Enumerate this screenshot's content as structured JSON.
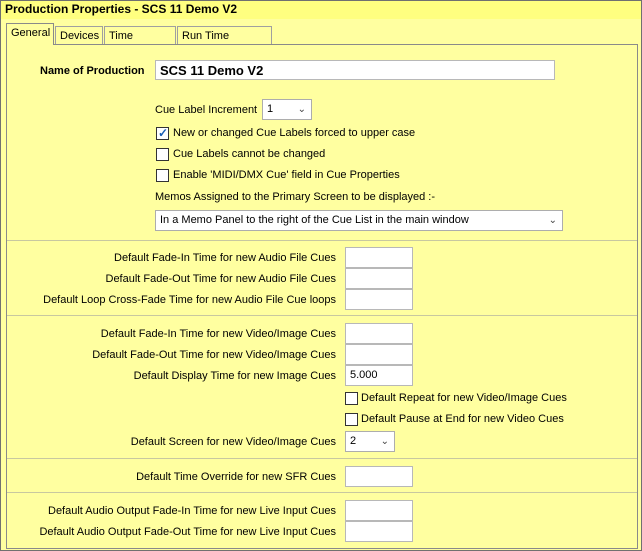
{
  "window": {
    "title": "Production Properties - SCS 11 Demo V2"
  },
  "tabs": [
    {
      "label": "General"
    },
    {
      "label": "Devices"
    },
    {
      "label": "Time Profiles"
    },
    {
      "label": "Run Time Settings"
    }
  ],
  "production": {
    "label": "Name of Production",
    "value": "SCS 11 Demo V2"
  },
  "cue_label_increment": {
    "label": "Cue Label Increment",
    "value": "1"
  },
  "checkboxes": {
    "upper_case": {
      "label": "New or changed Cue Labels forced to upper case",
      "checked": true
    },
    "cannot_change": {
      "label": "Cue Labels cannot be changed",
      "checked": false
    },
    "midi_dmx": {
      "label": "Enable 'MIDI/DMX Cue' field in Cue Properties",
      "checked": false
    },
    "repeat_video": {
      "label": "Default Repeat for new Video/Image Cues",
      "checked": false
    },
    "pause_end": {
      "label": "Default Pause at End for new Video Cues",
      "checked": false
    }
  },
  "memos": {
    "label": "Memos Assigned to the Primary Screen to be displayed :-",
    "value": "In a Memo Panel to the right of the Cue List in the main window"
  },
  "audio": {
    "fade_in": {
      "label": "Default Fade-In Time for new Audio File Cues",
      "value": ""
    },
    "fade_out": {
      "label": "Default Fade-Out Time for new Audio File Cues",
      "value": ""
    },
    "loop_xfade": {
      "label": "Default Loop Cross-Fade Time for new Audio File Cue loops",
      "value": ""
    }
  },
  "video": {
    "fade_in": {
      "label": "Default Fade-In Time for new Video/Image Cues",
      "value": ""
    },
    "fade_out": {
      "label": "Default Fade-Out Time for new Video/Image Cues",
      "value": ""
    },
    "display_time": {
      "label": "Default Display Time for new Image Cues",
      "value": "5.000"
    },
    "screen": {
      "label": "Default Screen for new Video/Image Cues",
      "value": "2"
    }
  },
  "sfr": {
    "label": "Default Time Override for new SFR Cues",
    "value": ""
  },
  "live_input": {
    "fade_in": {
      "label": "Default Audio Output Fade-In Time for new Live Input Cues",
      "value": ""
    },
    "fade_out": {
      "label": "Default Audio Output Fade-Out Time for new Live Input Cues",
      "value": ""
    }
  },
  "icons": {
    "dropdown": "chevron-down-icon",
    "check": "checkmark-icon"
  }
}
